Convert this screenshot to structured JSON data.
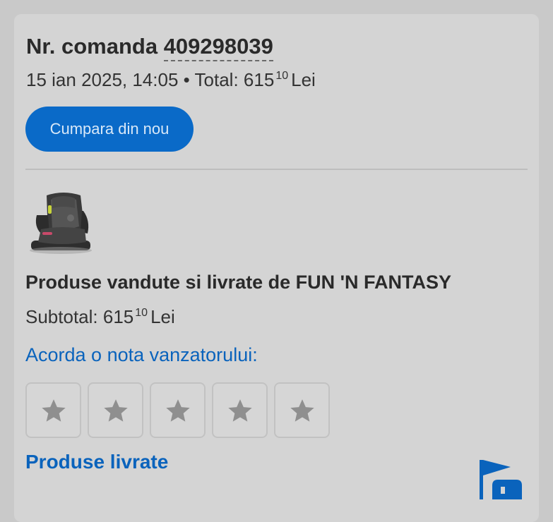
{
  "order": {
    "title_prefix": "Nr. comanda",
    "number": "409298039",
    "date": "15 ian 2025, 14:05",
    "separator": "•",
    "total_label": "Total:",
    "total_int": "615",
    "total_cents": "10",
    "currency": "Lei"
  },
  "actions": {
    "rebuy_label": "Cumpara din nou"
  },
  "product": {
    "thumbnail_icon": "car-seat-image"
  },
  "seller": {
    "line": "Produse vandute si livrate de FUN 'N FANTASY",
    "subtotal_label": "Subtotal:",
    "subtotal_int": "615",
    "subtotal_cents": "10",
    "currency": "Lei",
    "rate_label": "Acorda o nota vanzatorului:",
    "rating": 0,
    "max_rating": 5
  },
  "delivery": {
    "label": "Produse livrate",
    "icon": "flag-truck-icon"
  },
  "colors": {
    "accent": "#0a6ac8",
    "link": "#0a63bc",
    "star_empty": "#8f8f8f"
  }
}
